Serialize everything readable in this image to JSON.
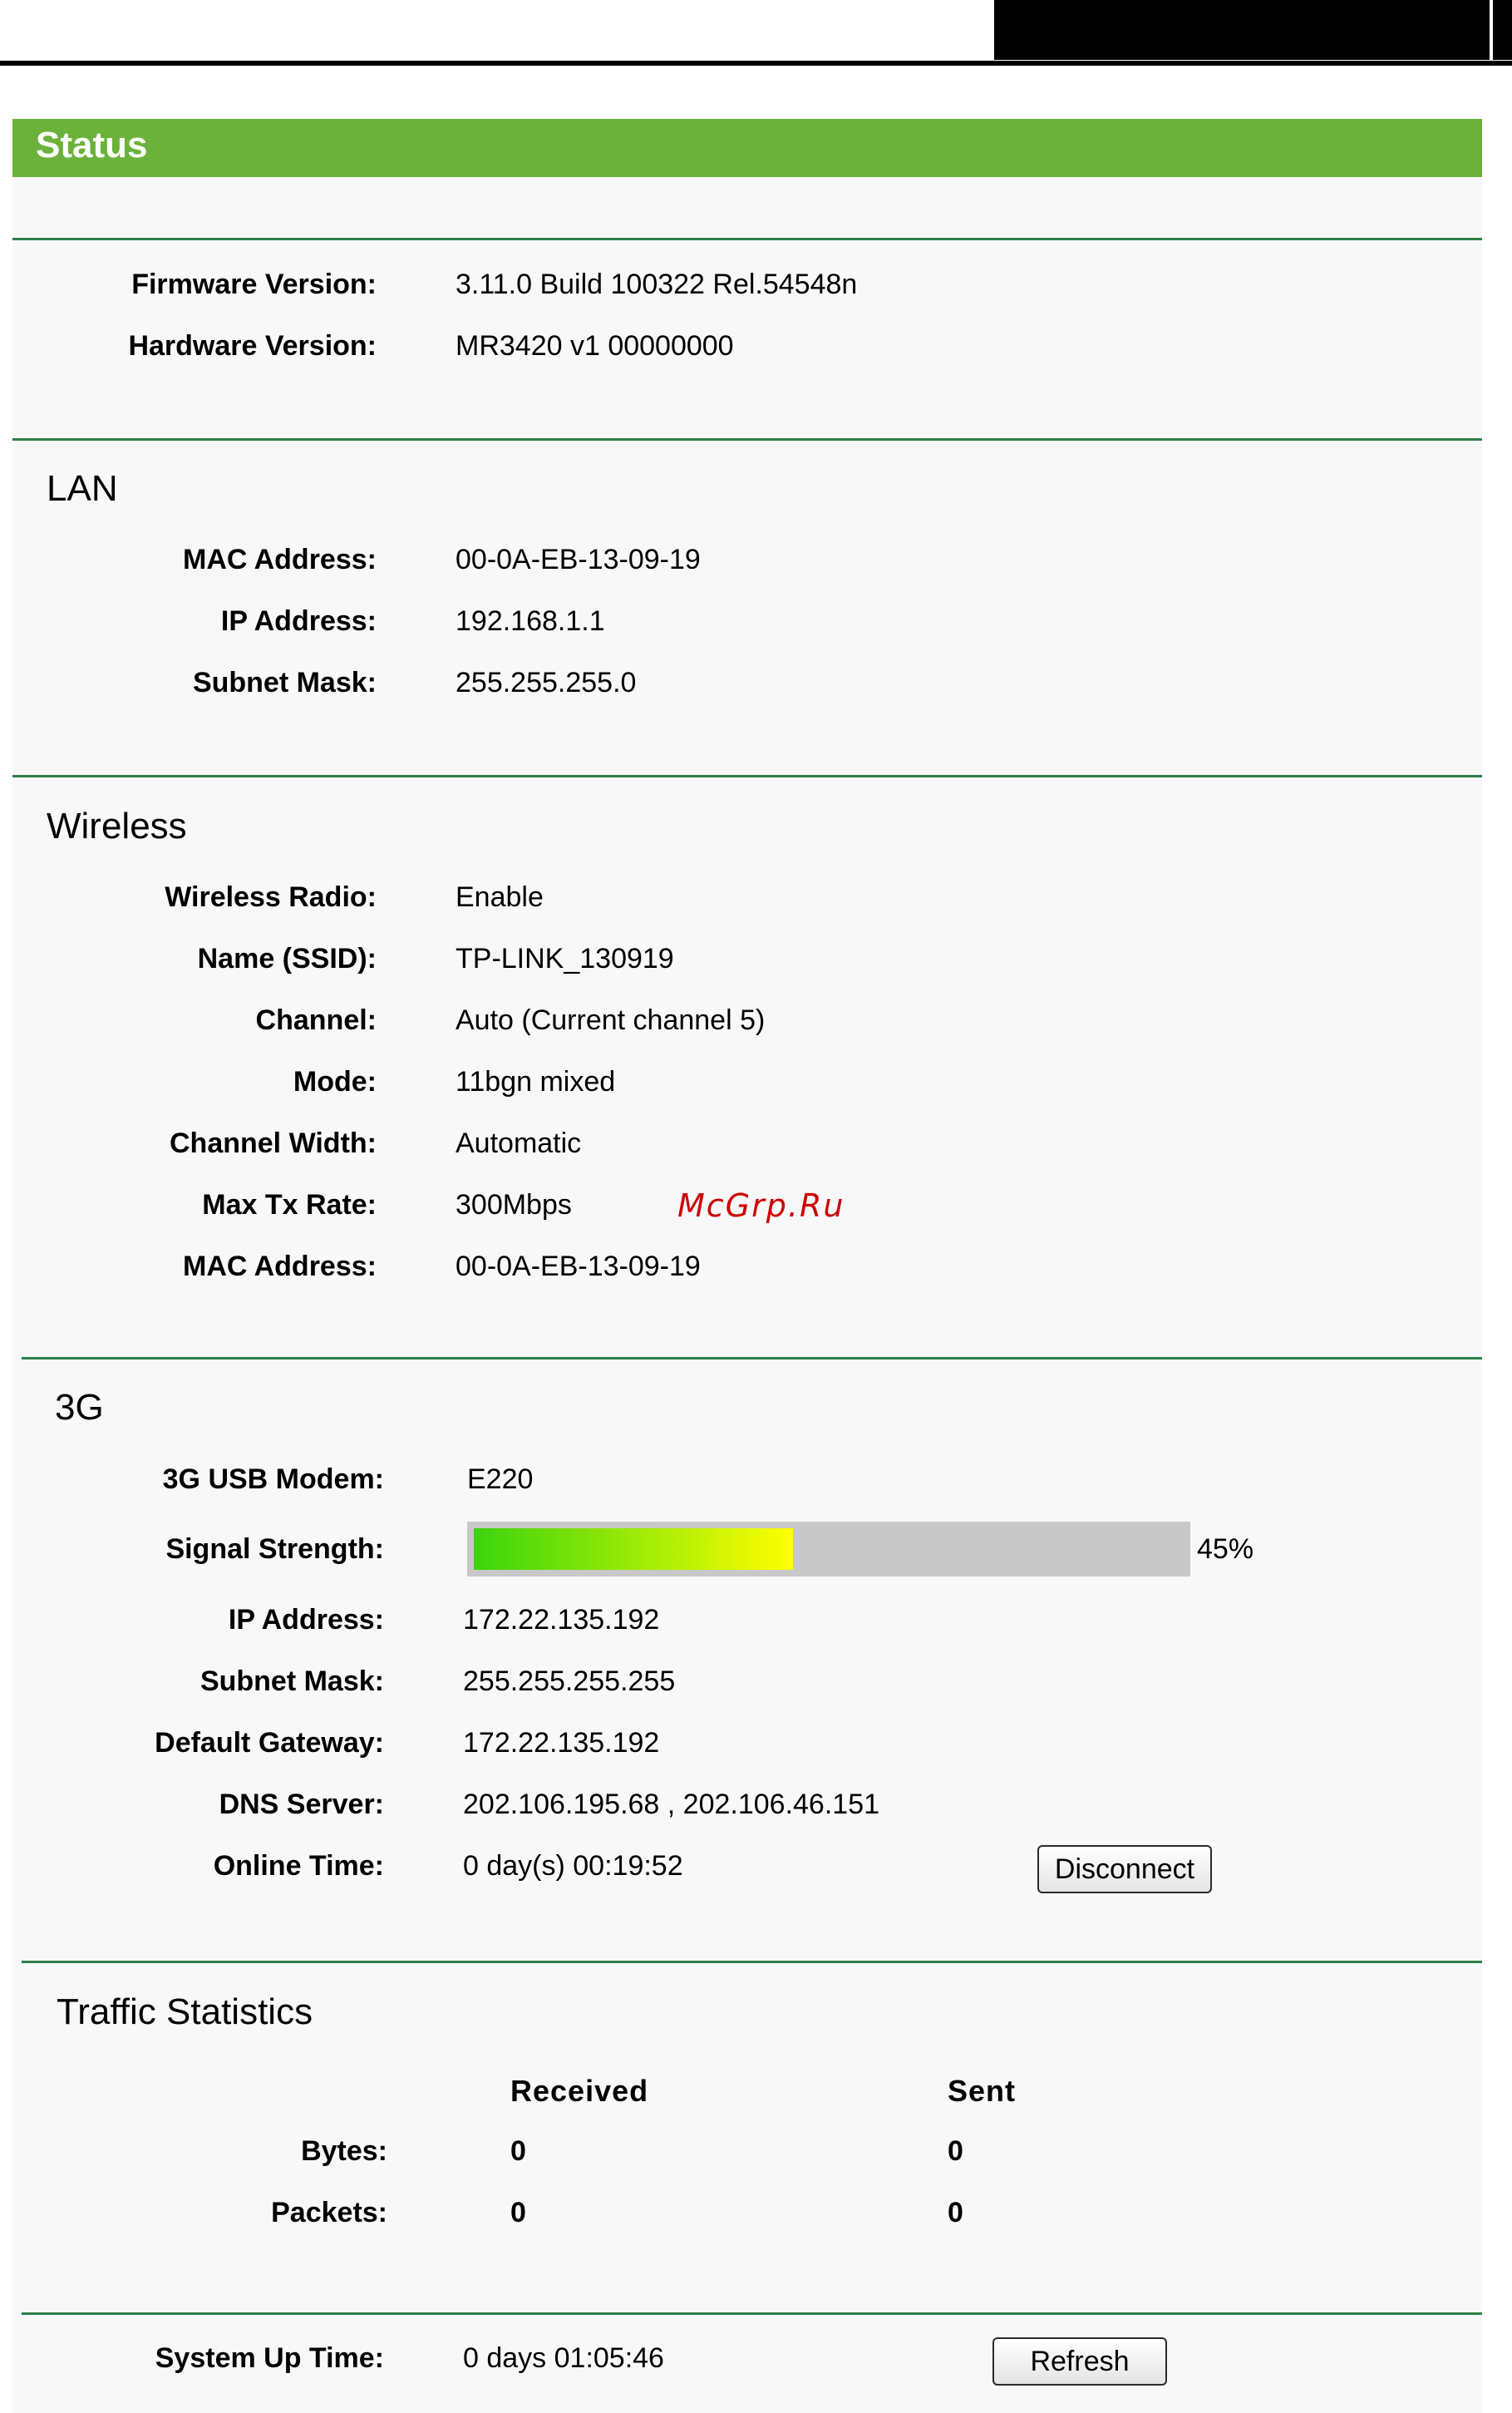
{
  "header": {
    "title": "Status"
  },
  "general": {
    "rows": [
      {
        "label": "Firmware Version:",
        "value": "3.11.0 Build 100322 Rel.54548n"
      },
      {
        "label": "Hardware Version:",
        "value": "MR3420 v1 00000000"
      }
    ]
  },
  "lan": {
    "title": "LAN",
    "rows": [
      {
        "label": "MAC Address:",
        "value": "00-0A-EB-13-09-19"
      },
      {
        "label": "IP Address:",
        "value": "192.168.1.1"
      },
      {
        "label": "Subnet Mask:",
        "value": "255.255.255.0"
      }
    ]
  },
  "wireless": {
    "title": "Wireless",
    "rows": [
      {
        "label": "Wireless Radio:",
        "value": "Enable"
      },
      {
        "label": "Name (SSID):",
        "value": "TP-LINK_130919"
      },
      {
        "label": "Channel:",
        "value": "Auto (Current channel 5)"
      },
      {
        "label": "Mode:",
        "value": "11bgn mixed"
      },
      {
        "label": "Channel Width:",
        "value": "Automatic"
      },
      {
        "label": "Max Tx Rate:",
        "value": "300Mbps"
      },
      {
        "label": "MAC Address:",
        "value": "00-0A-EB-13-09-19"
      }
    ],
    "watermark": "McGrp.Ru"
  },
  "g3": {
    "title": "3G",
    "modem": {
      "label": "3G USB Modem:",
      "value": "E220"
    },
    "signal": {
      "label": "Signal Strength:",
      "percent": 45,
      "percent_text": "45%"
    },
    "rows": [
      {
        "label": "IP Address:",
        "value": "172.22.135.192"
      },
      {
        "label": "Subnet Mask:",
        "value": "255.255.255.255"
      },
      {
        "label": "Default Gateway:",
        "value": "172.22.135.192"
      },
      {
        "label": "DNS Server:",
        "value": "202.106.195.68 , 202.106.46.151"
      }
    ],
    "online": {
      "label": "Online Time:",
      "value": "0 day(s) 00:19:52"
    },
    "disconnect_label": "Disconnect"
  },
  "traffic": {
    "title": "Traffic Statistics",
    "col_received": "Received",
    "col_sent": "Sent",
    "rows": [
      {
        "label": "Bytes:",
        "received": "0",
        "sent": "0"
      },
      {
        "label": "Packets:",
        "received": "0",
        "sent": "0"
      }
    ]
  },
  "uptime": {
    "label": "System Up Time:",
    "value": "0 days 01:05:46",
    "refresh_label": "Refresh"
  },
  "colors": {
    "accent": "#6bb23a",
    "divider": "#2f7f48",
    "signal_start": "#3ad40e",
    "signal_end": "#ffff00"
  }
}
